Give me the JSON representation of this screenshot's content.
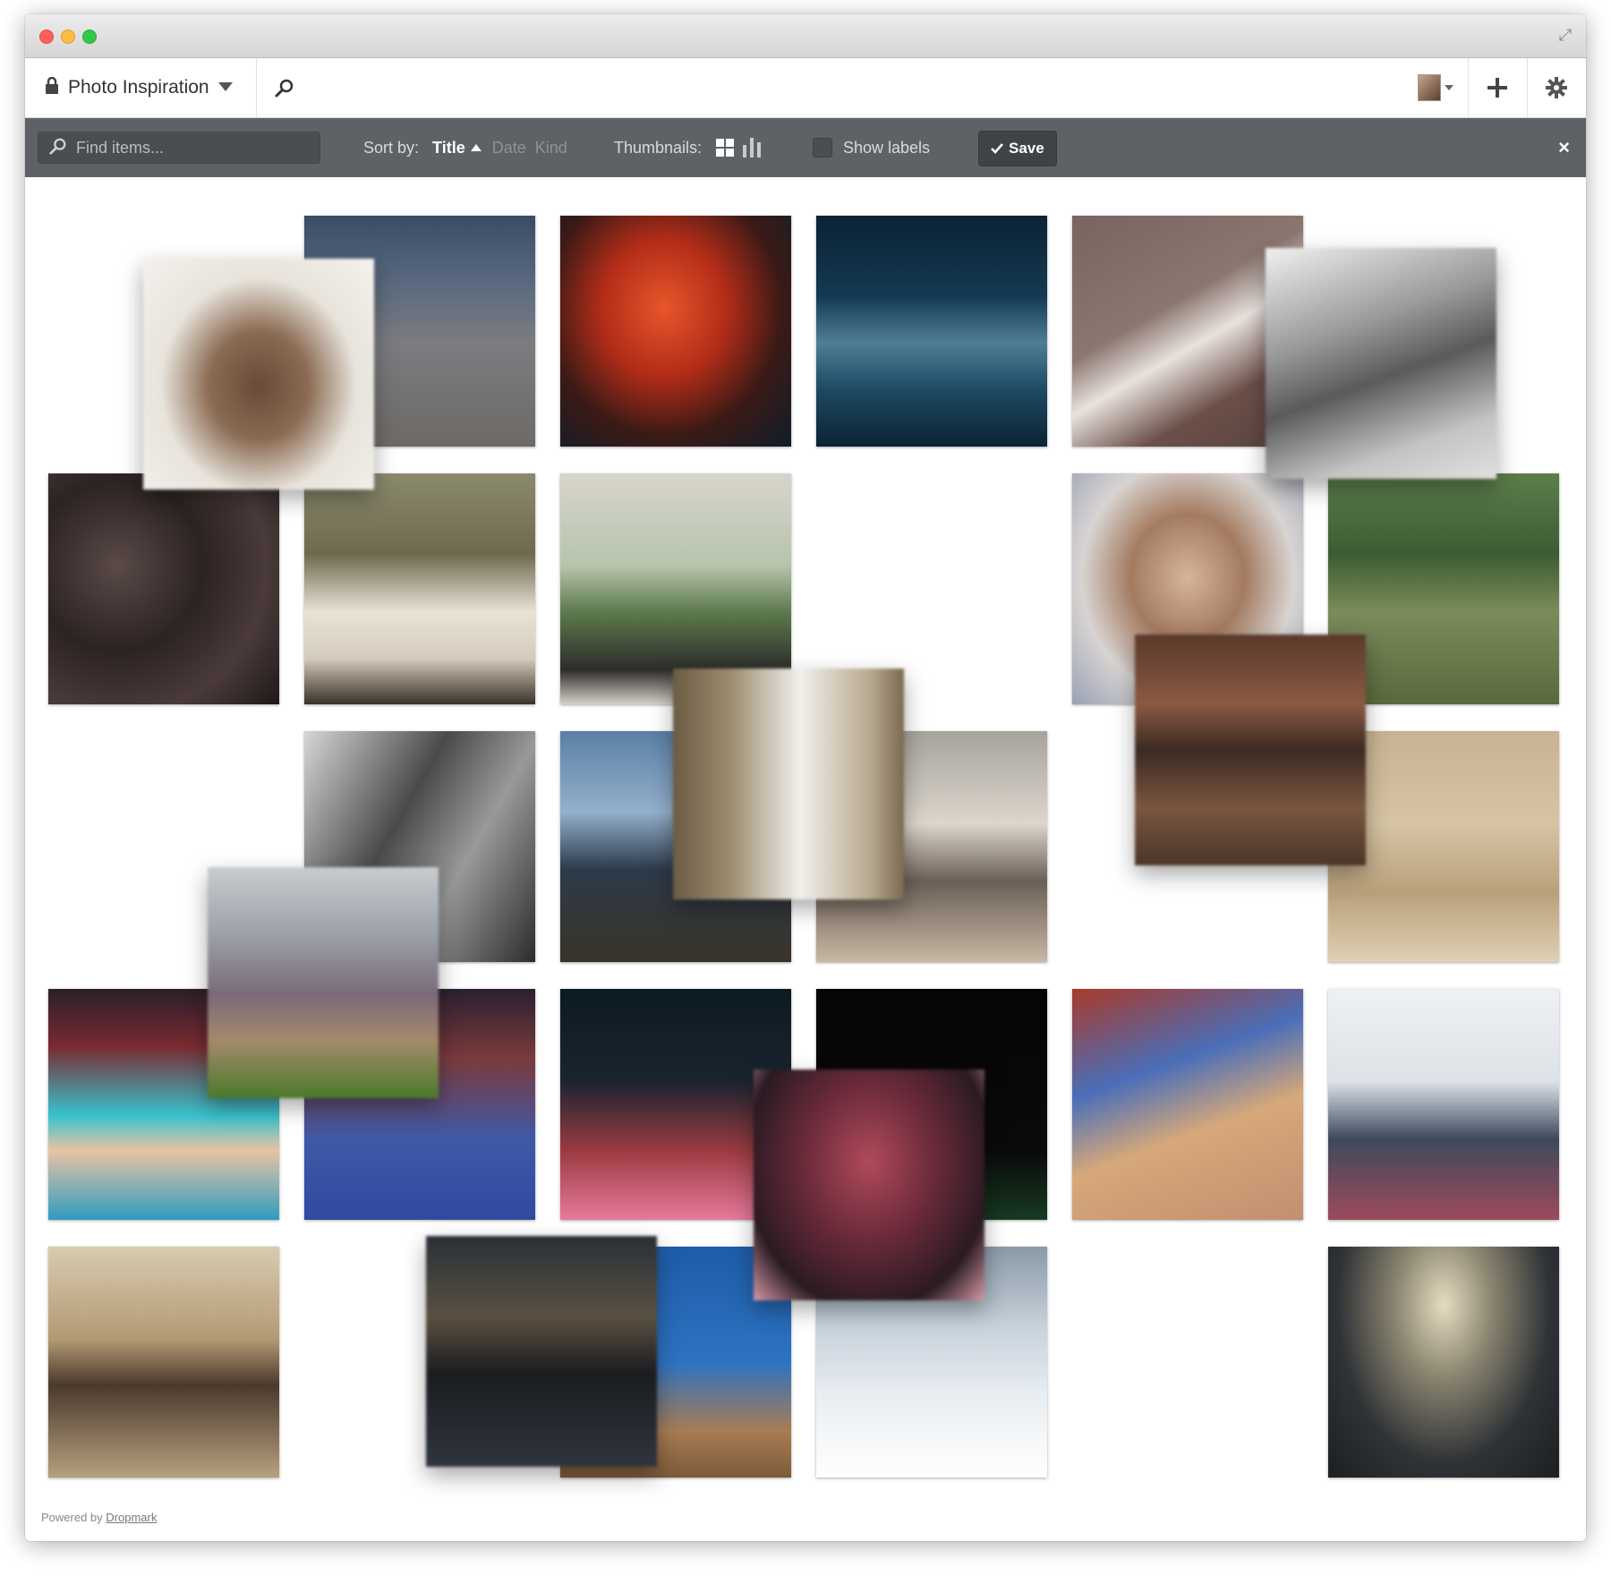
{
  "window": {
    "controls": [
      "close",
      "minimize",
      "zoom"
    ],
    "fullscreen_icon": "fullscreen-icon"
  },
  "header": {
    "lock_icon": "lock-icon",
    "collection_title": "Photo Inspiration",
    "dropdown_icon": "caret-down-icon",
    "search_icon": "search-icon",
    "add_icon": "plus-icon",
    "settings_icon": "gear-icon"
  },
  "toolbar": {
    "search_placeholder": "Find items...",
    "sort_label": "Sort by:",
    "sort_options": [
      "Title",
      "Date",
      "Kind"
    ],
    "sort_active": "Title",
    "thumbnails_label": "Thumbnails:",
    "thumb_icons": [
      "grid-icon",
      "bars-icon"
    ],
    "show_labels": "Show labels",
    "save_label": "Save",
    "close_label": "×"
  },
  "colors": {
    "toolbar_bg": "#5e6267",
    "save_bg": "#3f4347"
  },
  "tiles": [
    {
      "name": "ship-deck-photo",
      "bg": "linear-gradient(180deg,#3a4c66 0%,#5b6a80 30%,#7b7c80 55%,#6d6a66 100%)"
    },
    {
      "name": "volcano-eruption-photo",
      "bg": "radial-gradient(ellipse at 45% 40%,#e8562a 0%,#b22c18 35%,#3b1a16 65%,#0f1d2a 100%)"
    },
    {
      "name": "ocean-waves-photo",
      "bg": "linear-gradient(180deg,#0c2236 0%,#143a52 35%,#4e7f96 55%,#1e4a64 75%,#0b2233 100%)"
    },
    {
      "name": "jordan-jersey-photo",
      "bg": "linear-gradient(150deg,#7a6360 0%,#8b7670 40%,#e8e2de 55%,#6b4f48 75%,#5a4440 100%)"
    },
    {
      "name": "beetles-photo",
      "bg": "radial-gradient(circle at 30% 40%,#5a4a48 0%,#2c2322 40%,#4a3b3a 70%,#1d1818 100%)"
    },
    {
      "name": "floating-boy-bedroom-photo",
      "bg": "linear-gradient(180deg,#8c8a6e 0%,#6d6a4f 35%,#e9e3d6 60%,#d4cbbb 80%,#3a3128 100%)"
    },
    {
      "name": "baby-window-photo",
      "bg": "linear-gradient(180deg,#d8d4cc 0%,#b7c4ad 40%,#5c7a4d 60%,#2d2d2a 85%,#d6d0c8 100%)"
    },
    {
      "name": "hands-face-photo",
      "bg": "radial-gradient(ellipse at 50% 45%,#d6b49a 0%,#a47b60 35%,#d8d4d2 65%,#9aa1b4 100%)"
    },
    {
      "name": "croquet-men-photo",
      "bg": "linear-gradient(180deg,#5c7e4c 0%,#3d5c33 35%,#7c8b5a 60%,#58693c 100%)"
    },
    {
      "name": "kermit-bw-photo",
      "bg": "linear-gradient(120deg,#d6d6d6 0%,#4a4a4a 40%,#999 65%,#2c2c2c 100%)"
    },
    {
      "name": "man-seagulls-photo",
      "bg": "linear-gradient(180deg,#5b7fa6 0%,#94b0cb 35%,#2d3a4a 60%,#3a3328 100%)"
    },
    {
      "name": "basketball-players-photo",
      "bg": "linear-gradient(180deg,#a7a39c 0%,#dcd6cc 40%,#6b5f56 65%,#c7b8a4 100%)"
    },
    {
      "name": "equestrian-arena-photo",
      "bg": "linear-gradient(180deg,#c8b394 0%,#d6c4a4 40%,#b9a07a 70%,#e0d0b6 100%)"
    },
    {
      "name": "volleyball-court-photo",
      "bg": "linear-gradient(180deg,#2a1f2a 0%,#7a2a30 25%,#38c3cf 55%,#e8c3a4 70%,#2f9cbe 100%)"
    },
    {
      "name": "london-2012-photo",
      "bg": "linear-gradient(180deg,#2a2030 0%,#7a3a3c 30%,#4059a6 65%,#2f4aa0 100%)"
    },
    {
      "name": "gymnast-trampoline-photo",
      "bg": "linear-gradient(180deg,#0c1a22 0%,#1a2430 40%,#9a3a40 70%,#e77a9c 100%)"
    },
    {
      "name": "dark-stadium-photo",
      "bg": "linear-gradient(180deg,#050505 0%,#0a0a0a 70%,#173a22 100%)"
    },
    {
      "name": "cyclists-velodrome-photo",
      "bg": "linear-gradient(160deg,#a83a2a 0%,#4a6eb8 35%,#d6a87a 60%,#c09070 100%)"
    },
    {
      "name": "olympic-stadium-photo",
      "bg": "linear-gradient(180deg,#eef1f4 0%,#dde2e7 40%,#3d4a5c 65%,#9c4a5c 100%)"
    },
    {
      "name": "white-house-hallway-photo",
      "bg": "linear-gradient(180deg,#d8cbb0 0%,#b49a74 40%,#4a3a2c 60%,#b7a07e 100%)"
    },
    {
      "name": "climbing-ropes-photo",
      "bg": "linear-gradient(180deg,#1e5ca8 0%,#2d73c2 50%,#a97c52 80%,#7c5a3a 100%)"
    },
    {
      "name": "ice-rink-photo",
      "bg": "linear-gradient(180deg,#8a9aa8 0%,#c7d2db 35%,#e9eef2 65%,#ffffff 100%)"
    },
    {
      "name": "sunset-water-photo",
      "bg": "radial-gradient(ellipse at 50% 25%,#e6dcc0 0%,#8a8470 30%,#2f3236 65%,#1c1e22 100%)"
    },
    {
      "name": "blurred-bird-photo",
      "bg": "radial-gradient(ellipse at 50% 55%,#6a4a38 0%,#8a6a52 30%,#e8e4dc 60%,#f4f2ee 100%)"
    },
    {
      "name": "blurred-car-photo",
      "bg": "linear-gradient(160deg,#f0f0f0 0%,#9a9a9a 35%,#5a5a5a 55%,#c4c4c4 80%,#e0e0e0 100%)"
    },
    {
      "name": "blurred-falling-figure-photo",
      "bg": "linear-gradient(90deg,#6b5c44 0%,#9c8c70 25%,#f2f0ec 55%,#b8aa90 85%,#7a6a50 100%)"
    },
    {
      "name": "blurred-hair-photo",
      "bg": "linear-gradient(180deg,#5a3a2c 0%,#8a5a42 30%,#3c2a22 50%,#7a5640 75%,#4a3628 100%)"
    },
    {
      "name": "blurred-crowd-photo",
      "bg": "linear-gradient(180deg,#c8ccd0 0%,#9aa0a6 30%,#7a6a7a 55%,#a48a6a 75%,#4a7a2a 100%)"
    },
    {
      "name": "blurred-gymnast-photo",
      "bg": "radial-gradient(ellipse at 50% 40%,#b04a5a 0%,#6a2a3a 40%,#2a1a22 75%,#d49aa6 100%)"
    },
    {
      "name": "blurred-dark-shore-photo",
      "bg": "linear-gradient(180deg,#2a3038 0%,#5a5040 35%,#1a1c20 60%,#30363e 100%)"
    }
  ],
  "footer": {
    "powered_by": "Powered by",
    "link_label": "Dropmark"
  }
}
